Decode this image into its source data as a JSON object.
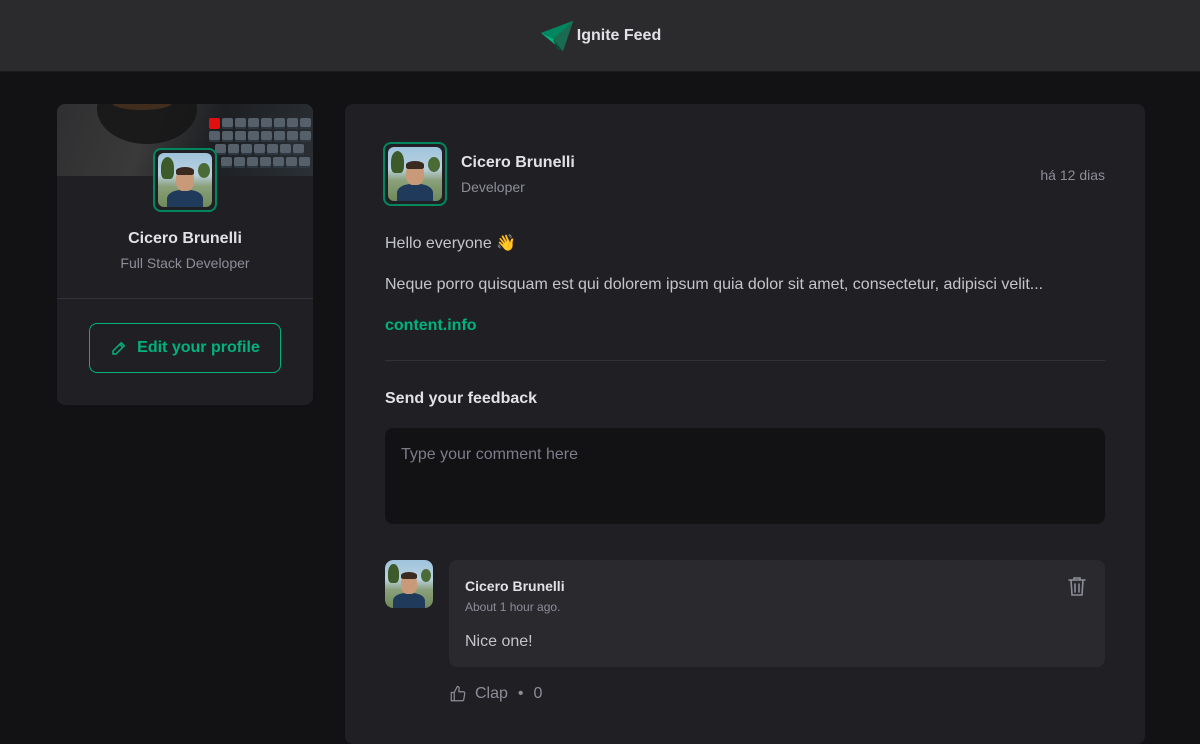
{
  "header": {
    "app_title": "Ignite Feed",
    "logo_icon": "ignite-logo-icon",
    "brand_color": "#00b37e"
  },
  "sidebar": {
    "name": "Cicero Brunelli",
    "role": "Full Stack Developer",
    "edit_button_label": "Edit your profile",
    "edit_icon": "pencil-icon"
  },
  "post": {
    "author": {
      "name": "Cicero Brunelli",
      "role": "Developer"
    },
    "published": "há 12 dias",
    "greeting": "Hello everyone 👋",
    "body": "Neque porro quisquam est qui dolorem ipsum quia dolor sit amet, consectetur, adipisci velit...",
    "link": "content.info",
    "feedback_title": "Send your feedback",
    "comment_placeholder": "Type your comment here"
  },
  "comments": [
    {
      "author": "Cicero Brunelli",
      "time": "About 1 hour ago.",
      "text": "Nice one!",
      "clap_label": "Clap",
      "clap_separator": "•",
      "clap_count": "0",
      "delete_icon": "trash-icon",
      "clap_icon": "thumbs-up-icon"
    }
  ]
}
